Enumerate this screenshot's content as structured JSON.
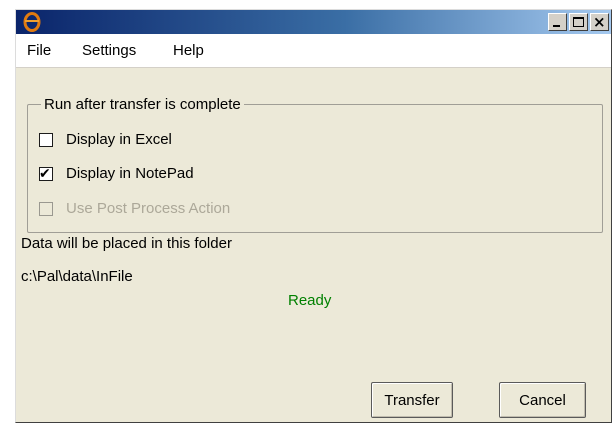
{
  "window": {
    "icon": "app-logo-icon",
    "caption_buttons": [
      "minimize-icon",
      "maximize-icon",
      "close-icon"
    ]
  },
  "menu": {
    "file": "File",
    "settings": "Settings",
    "help": "Help"
  },
  "group": {
    "title": "Run after transfer is complete",
    "options": [
      {
        "label": "Display in Excel",
        "checked": false,
        "enabled": true
      },
      {
        "label": "Display in NotePad",
        "checked": true,
        "enabled": true
      },
      {
        "label": "Use Post Process Action",
        "checked": false,
        "enabled": false
      }
    ]
  },
  "folder": {
    "caption": "Data will be placed in this folder",
    "path": "c:\\Pal\\data\\InFile"
  },
  "status": {
    "text": "Ready",
    "color": "#008000"
  },
  "buttons": {
    "transfer": "Transfer",
    "cancel": "Cancel"
  }
}
